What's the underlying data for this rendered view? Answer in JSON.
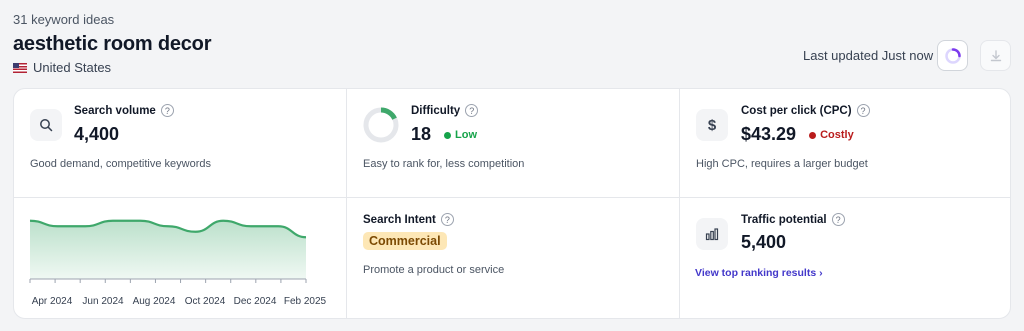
{
  "header": {
    "idea_count": "31 keyword ideas",
    "keyword": "aesthetic room decor",
    "country": "United States"
  },
  "toolbar": {
    "last_updated": "Last updated Just now",
    "refresh_icon": "loading-spinner-icon",
    "download_icon": "download-icon"
  },
  "metrics": {
    "search_volume": {
      "title": "Search volume",
      "value": "4,400",
      "description": "Good demand, competitive keywords",
      "icon": "search-icon"
    },
    "difficulty": {
      "title": "Difficulty",
      "value": "18",
      "level": "Low",
      "level_color": "#16a34a",
      "description": "Easy to rank for, less competition",
      "gauge_fraction": 0.18
    },
    "cpc": {
      "title": "Cost per click (CPC)",
      "value": "$43.29",
      "level": "Costly",
      "level_color": "#b91c1c",
      "description": "High CPC, requires a larger budget",
      "icon": "dollar-icon"
    },
    "intent": {
      "title": "Search Intent",
      "value": "Commercial",
      "description": "Promote a product or service"
    },
    "traffic": {
      "title": "Traffic potential",
      "value": "5,400",
      "link": "View top ranking results ›",
      "icon": "bar-chart-icon"
    }
  },
  "chart_data": {
    "type": "area",
    "x_labels": [
      "Apr 2024",
      "Jun 2024",
      "Aug 2024",
      "Oct 2024",
      "Dec 2024",
      "Feb 2025"
    ],
    "values": [
      4600,
      4400,
      4400,
      4600,
      4600,
      4400,
      4200,
      4600,
      4400,
      4400,
      4000
    ],
    "ylim": [
      0,
      5000
    ],
    "color": "#3fa86b"
  }
}
